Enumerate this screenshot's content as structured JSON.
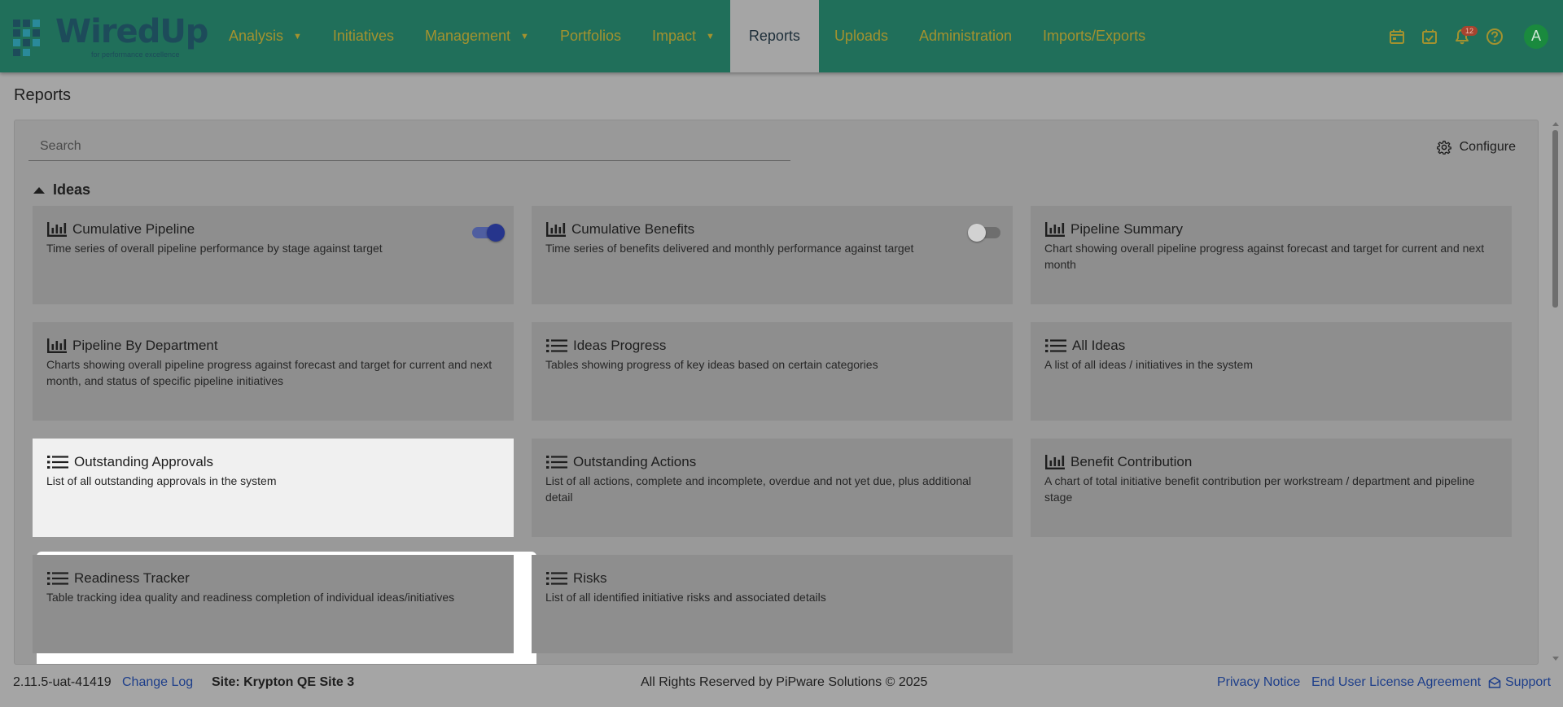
{
  "header": {
    "logo_text": "WiredUp",
    "logo_tagline": "for performance excellence",
    "nav": [
      {
        "label": "Analysis",
        "caret": true
      },
      {
        "label": "Initiatives",
        "caret": false
      },
      {
        "label": "Management",
        "caret": true
      },
      {
        "label": "Portfolios",
        "caret": false
      },
      {
        "label": "Impact",
        "caret": true
      },
      {
        "label": "Reports",
        "caret": false,
        "active": true
      },
      {
        "label": "Uploads",
        "caret": false
      },
      {
        "label": "Administration",
        "caret": false
      },
      {
        "label": "Imports/Exports",
        "caret": false
      }
    ],
    "notification_count": "12",
    "avatar_initial": "A",
    "icons": [
      "calendar-icon",
      "calendar-check-icon",
      "bell-icon",
      "help-icon"
    ]
  },
  "page": {
    "title": "Reports",
    "search_placeholder": "Search",
    "configure_label": "Configure",
    "section_title": "Ideas"
  },
  "cards": [
    {
      "title": "Cumulative Pipeline",
      "desc": "Time series of overall pipeline performance by stage against target",
      "icon": "bar-chart-icon",
      "toggle": "on"
    },
    {
      "title": "Cumulative Benefits",
      "desc": "Time series of benefits delivered and monthly performance against target",
      "icon": "bar-chart-icon",
      "toggle": "off"
    },
    {
      "title": "Pipeline Summary",
      "desc": "Chart showing overall pipeline progress against forecast and target for current and next month",
      "icon": "bar-chart-icon"
    },
    {
      "title": "Pipeline By Department",
      "desc": "Charts showing overall pipeline progress against forecast and target for current and next month, and status of specific pipeline initiatives",
      "icon": "bar-chart-icon"
    },
    {
      "title": "Ideas Progress",
      "desc": "Tables showing progress of key ideas based on certain categories",
      "icon": "list-icon"
    },
    {
      "title": "All Ideas",
      "desc": "A list of all ideas / initiatives in the system",
      "icon": "list-icon"
    },
    {
      "title": "Outstanding Approvals",
      "desc": "List of all outstanding approvals in the system",
      "icon": "list-icon",
      "highlighted": true
    },
    {
      "title": "Outstanding Actions",
      "desc": "List of all actions, complete and incomplete, overdue and not yet due, plus additional detail",
      "icon": "list-icon"
    },
    {
      "title": "Benefit Contribution",
      "desc": "A chart of total initiative benefit contribution per workstream / department and pipeline stage",
      "icon": "bar-chart-icon"
    },
    {
      "title": "Readiness Tracker",
      "desc": "Table tracking idea quality and readiness completion of individual ideas/initiatives",
      "icon": "list-icon"
    },
    {
      "title": "Risks",
      "desc": "List of all identified initiative risks and associated details",
      "icon": "list-icon"
    }
  ],
  "footer": {
    "version": "2.11.5-uat-41419",
    "change_log": "Change Log",
    "site": "Site: Krypton QE Site 3",
    "rights": "All Rights Reserved by PiPware Solutions © 2025",
    "privacy": "Privacy Notice",
    "eula": "End User License Agreement",
    "support": "Support"
  },
  "colors": {
    "header_bg": "#206f5a",
    "nav_text": "#a3922f",
    "link": "#1d3e8a",
    "toggle_on": "#26358c",
    "avatar": "#1a8a3e"
  }
}
